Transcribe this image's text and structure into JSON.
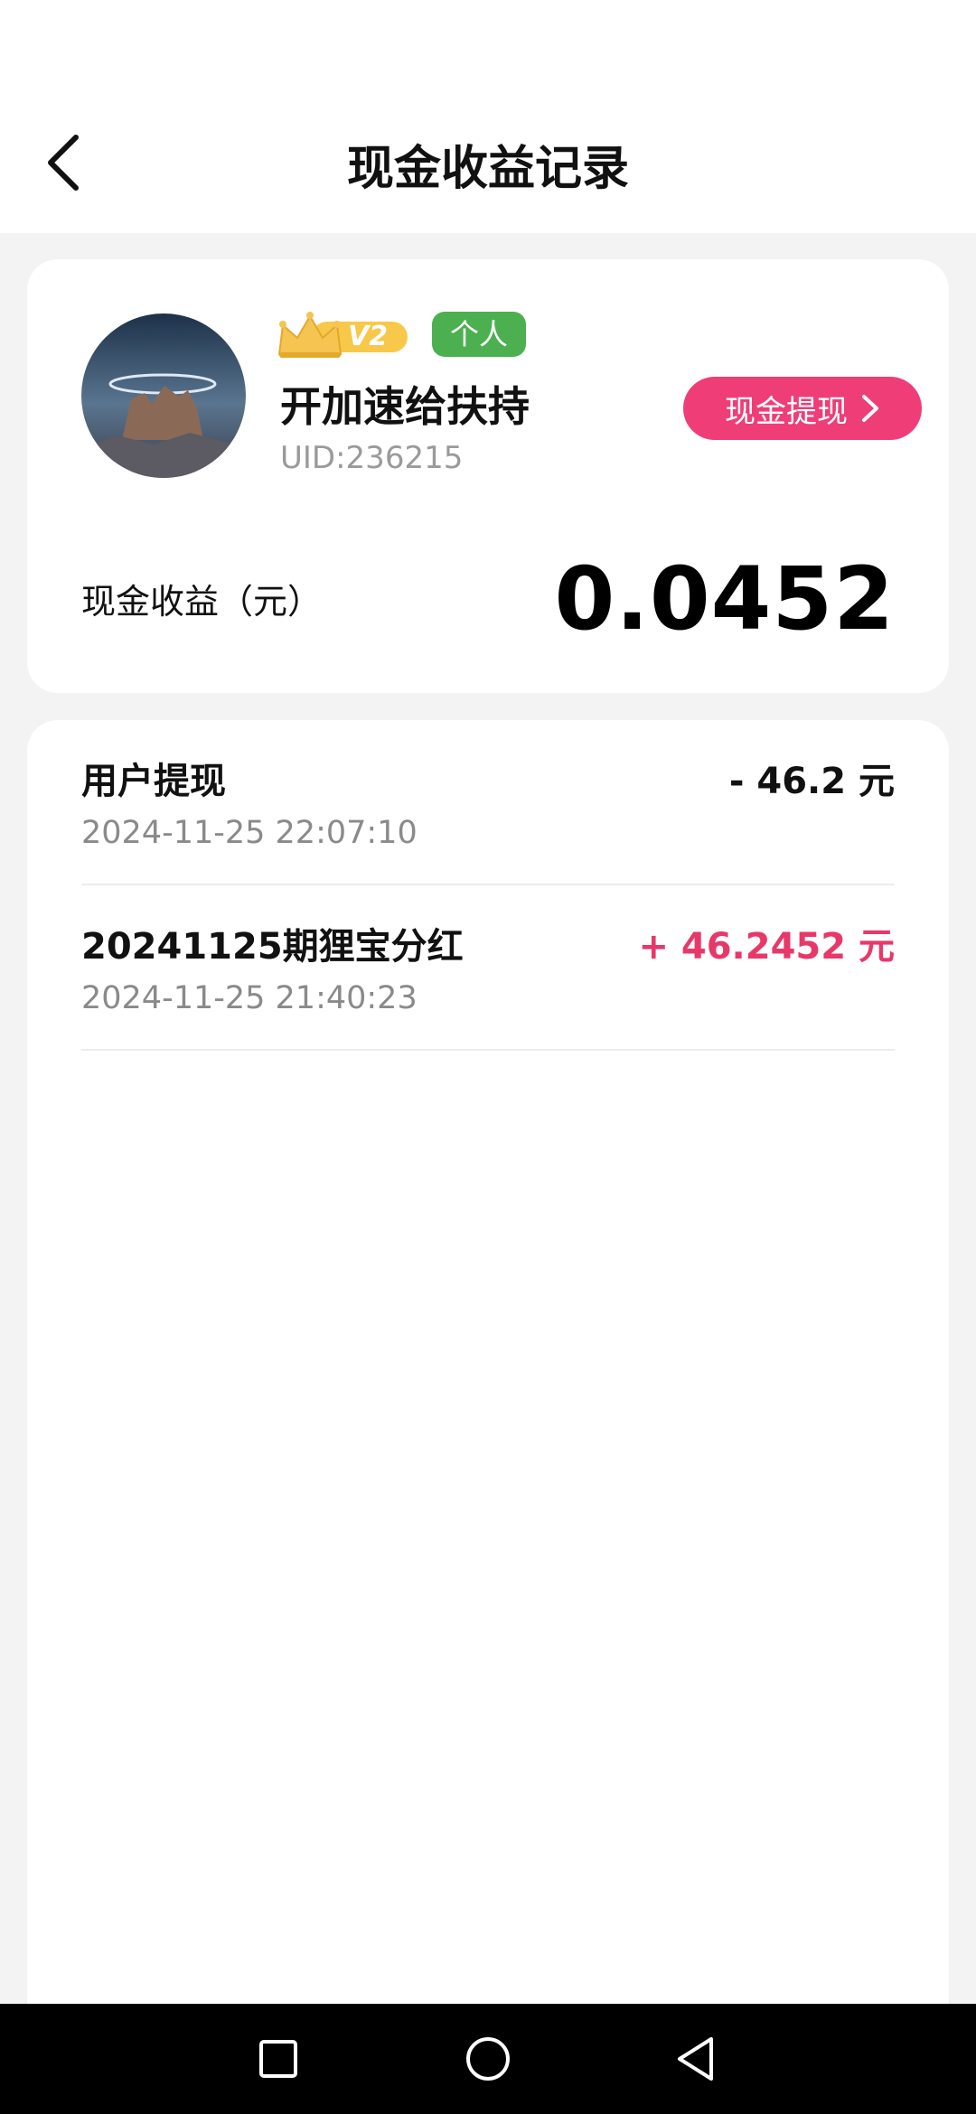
{
  "header": {
    "title": "现金收益记录"
  },
  "profile": {
    "vip_level": "V2",
    "tag": "个人",
    "name": "开加速给扶持",
    "uid": "UID:236215",
    "withdraw_label": "现金提现",
    "earn_label": "现金收益（元）",
    "earn_value": "0.0452"
  },
  "records": [
    {
      "title": "用户提现",
      "amount": "- 46.2 元",
      "time": "2024-11-25 22:07:10",
      "color": "#111111"
    },
    {
      "title": "20241125期狸宝分红",
      "amount": "+ 46.2452 元",
      "time": "2024-11-25 21:40:23",
      "color": "#e8386a"
    }
  ],
  "colors": {
    "accent": "#ef3d78",
    "tag_green": "#4cb050",
    "positive": "#e8386a"
  },
  "nav": {
    "icons": [
      "recent-apps-icon",
      "home-icon",
      "back-icon"
    ]
  }
}
